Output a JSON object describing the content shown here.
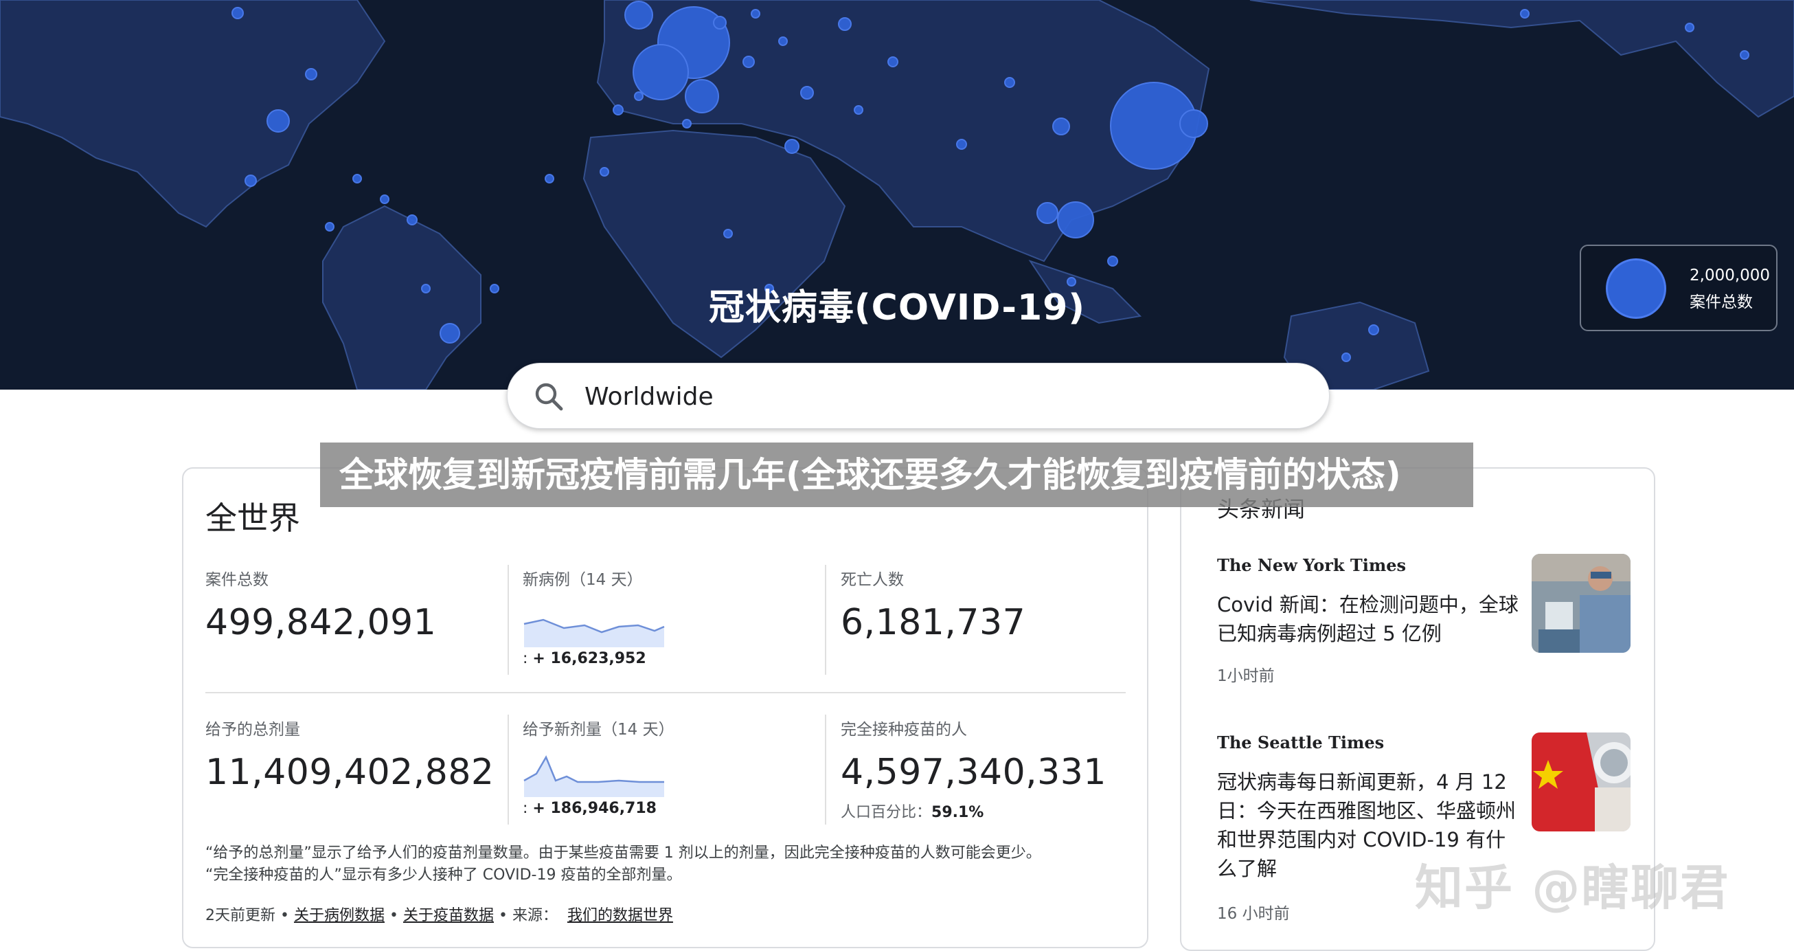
{
  "map": {
    "title": "冠状病毒(COVID-19)",
    "legend": {
      "value": "2,000,000",
      "label": "案件总数"
    },
    "colors": {
      "ocean": "#0f1a2e",
      "land": "#1c2e5a",
      "borders": "#34508e",
      "bubble": "#2f62d6"
    }
  },
  "search": {
    "value": "Worldwide",
    "icon": "search-icon"
  },
  "overlay": {
    "caption": "全球恢复到新冠疫情前需几年(全球还要多久才能恢复到疫情前的状态)"
  },
  "stats": {
    "title": "全世界",
    "cases": {
      "label": "案件总数",
      "value": "499,842,091"
    },
    "new_cases": {
      "label": "新病例（14 天）",
      "prefix": ": ",
      "value": "+ 16,623,952"
    },
    "deaths": {
      "label": "死亡人数",
      "value": "6,181,737"
    },
    "doses": {
      "label": "给予的总剂量",
      "value": "11,409,402,882"
    },
    "new_doses": {
      "label": "给予新剂量（14 天）",
      "prefix": ": ",
      "value": "+ 186,946,718"
    },
    "vaccinated": {
      "label": "完全接种疫苗的人",
      "value": "4,597,340,331",
      "pct_label": "人口百分比：",
      "pct_value": "59.1%"
    },
    "footnote_1": "“给予的总剂量”显示了给予人们的疫苗剂量数量。由于某些疫苗需要 1 剂以上的剂量，因此完全接种疫苗的人数可能会更少。",
    "footnote_2": "“完全接种疫苗的人”显示有多少人接种了 COVID-19 疫苗的全部剂量。",
    "footer": {
      "updated": "2天前更新",
      "sep": " • ",
      "case_link": "关于病例数据",
      "vaccine_link": "关于疫苗数据",
      "source_label": "来源：",
      "source_link": "我们的数据世界"
    }
  },
  "news": {
    "heading": "头条新闻",
    "items": [
      {
        "source": "The New York Times",
        "headline": "Covid 新闻：在检测问题中，全球已知病毒病例超过 5 亿例",
        "time": "1小时前"
      },
      {
        "source": "The Seattle Times",
        "headline": "冠状病毒每日新闻更新，4 月 12 日：今天在西雅图地区、华盛顿州和世界范围内对 COVID-19 有什么了解",
        "time": "16 小时前"
      }
    ]
  },
  "watermark": "知乎 @瞎聊君"
}
